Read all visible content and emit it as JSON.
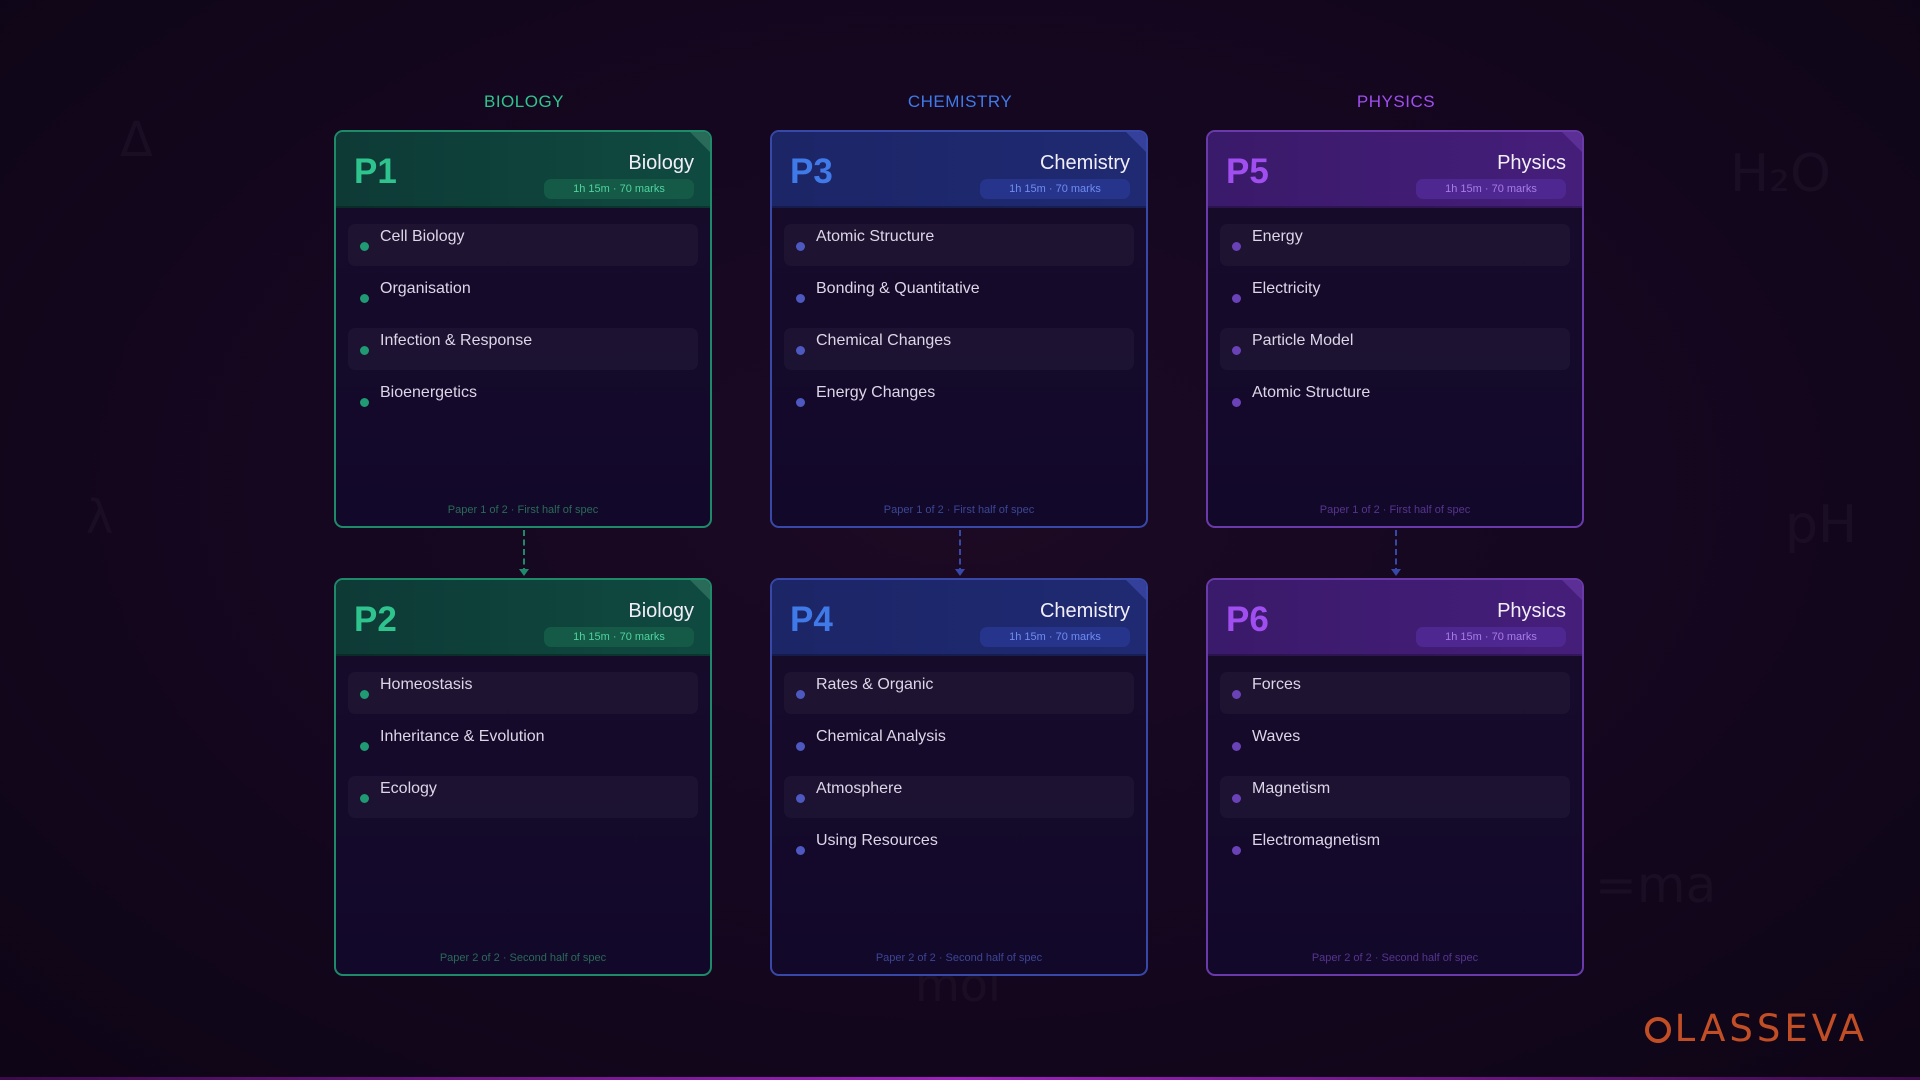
{
  "background_glyphs": [
    "Δ",
    "H₂O",
    "λ",
    "pH",
    "=ma",
    "mol"
  ],
  "columns": [
    {
      "title": "BIOLOGY",
      "color": "#2fc48e"
    },
    {
      "title": "CHEMISTRY",
      "color": "#3f7ae8"
    },
    {
      "title": "PHYSICS",
      "color": "#a04ef0"
    }
  ],
  "cards": [
    {
      "code": "P1",
      "subject": "Biology",
      "badge": "1h 15m · 70 marks",
      "topics": [
        "Cell Biology",
        "Organisation",
        "Infection & Response",
        "Bioenergetics"
      ],
      "footer": "Paper 1 of 2  ·  First half of spec"
    },
    {
      "code": "P3",
      "subject": "Chemistry",
      "badge": "1h 15m · 70 marks",
      "topics": [
        "Atomic Structure",
        "Bonding & Quantitative",
        "Chemical Changes",
        "Energy Changes"
      ],
      "footer": "Paper 1 of 2  ·  First half of spec"
    },
    {
      "code": "P5",
      "subject": "Physics",
      "badge": "1h 15m · 70 marks",
      "topics": [
        "Energy",
        "Electricity",
        "Particle Model",
        "Atomic Structure"
      ],
      "footer": "Paper 1 of 2  ·  First half of spec"
    },
    {
      "code": "P2",
      "subject": "Biology",
      "badge": "1h 15m · 70 marks",
      "topics": [
        "Homeostasis",
        "Inheritance & Evolution",
        "Ecology"
      ],
      "footer": "Paper 2 of 2  ·  Second half of spec"
    },
    {
      "code": "P4",
      "subject": "Chemistry",
      "badge": "1h 15m · 70 marks",
      "topics": [
        "Rates & Organic",
        "Chemical Analysis",
        "Atmosphere",
        "Using Resources"
      ],
      "footer": "Paper 2 of 2  ·  Second half of spec"
    },
    {
      "code": "P6",
      "subject": "Physics",
      "badge": "1h 15m · 70 marks",
      "topics": [
        "Forces",
        "Waves",
        "Magnetism",
        "Electromagnetism"
      ],
      "footer": "Paper 2 of 2  ·  Second half of spec"
    }
  ],
  "logo": {
    "text": "LASSEVA",
    "color": "#c24e26"
  }
}
